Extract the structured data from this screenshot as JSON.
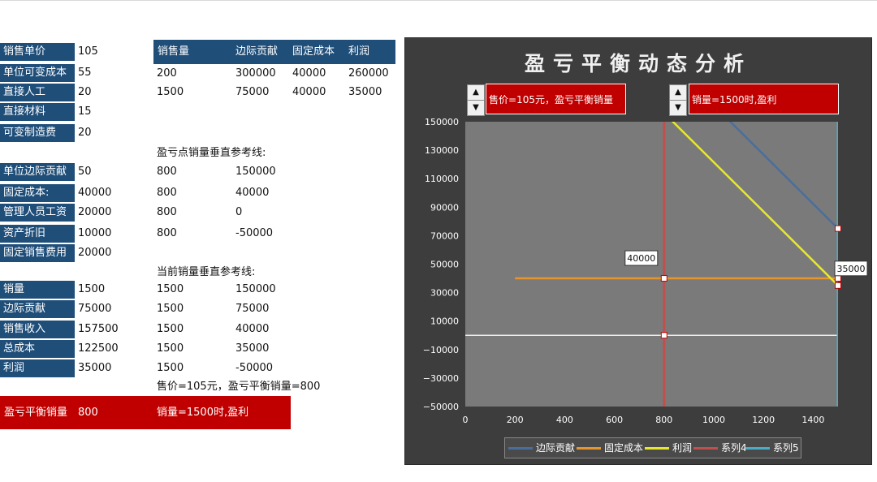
{
  "left_table": {
    "rows_a": [
      {
        "label": "销售单价",
        "value": "105"
      },
      {
        "label": "单位可变成本",
        "value": "55"
      },
      {
        "label": "直接人工",
        "value": "20"
      },
      {
        "label": "直接材料",
        "value": "15"
      },
      {
        "label": "可变制造费",
        "value": "20"
      }
    ],
    "rows_b": [
      {
        "label": "单位边际贡献",
        "value": "50"
      },
      {
        "label": "固定成本:",
        "value": "40000"
      },
      {
        "label": "管理人员工资",
        "value": "20000"
      },
      {
        "label": "资产折旧",
        "value": "10000"
      },
      {
        "label": "固定销售费用",
        "value": "20000"
      }
    ],
    "rows_c": [
      {
        "label": "销量",
        "value": "1500"
      },
      {
        "label": "边际贡献",
        "value": "75000"
      },
      {
        "label": "销售收入",
        "value": "157500"
      },
      {
        "label": "总成本",
        "value": "122500"
      },
      {
        "label": "利润",
        "value": "35000"
      }
    ]
  },
  "header": {
    "c1": "销售量",
    "c2": "边际贡献",
    "c3": "固定成本",
    "c4": "利润"
  },
  "table_rows": [
    {
      "c1": "200",
      "c2": "300000",
      "c3": "40000",
      "c4": "260000"
    },
    {
      "c1": "1500",
      "c2": "75000",
      "c3": "40000",
      "c4": "35000"
    }
  ],
  "ref1": {
    "title": "盈亏点销量垂直参考线:",
    "rows": [
      {
        "a": "800",
        "b": "150000"
      },
      {
        "a": "800",
        "b": "40000"
      },
      {
        "a": "800",
        "b": "0"
      },
      {
        "a": "800",
        "b": "-50000"
      }
    ]
  },
  "ref2": {
    "title": "当前销量垂直参考线:",
    "rows": [
      {
        "a": "1500",
        "b": "150000"
      },
      {
        "a": "1500",
        "b": "75000"
      },
      {
        "a": "1500",
        "b": "40000"
      },
      {
        "a": "1500",
        "b": "35000"
      },
      {
        "a": "1500",
        "b": "-50000"
      }
    ]
  },
  "summary_text": "售价=105元，盈亏平衡销量=800",
  "bottom_bar": {
    "label": "盈亏平衡销量",
    "value": "800",
    "status": "销量=1500时,盈利"
  },
  "chart": {
    "title": "盈亏平衡动态分析",
    "box1": "售价=105元，盈亏平衡销量=800",
    "box2": "销量=1500时,盈利",
    "spin_up": "▲",
    "spin_down": "▼"
  },
  "chart_data": {
    "type": "line",
    "xlim": [
      0,
      1500
    ],
    "ylim": [
      -50000,
      150000
    ],
    "xticks": [
      0,
      200,
      400,
      600,
      800,
      1000,
      1200,
      1400
    ],
    "yticks": [
      150000,
      130000,
      110000,
      90000,
      70000,
      50000,
      30000,
      10000,
      -10000,
      -30000,
      -50000
    ],
    "series": [
      {
        "name": "边际贡献",
        "color": "#4a6e9b",
        "x": [
          200,
          1500
        ],
        "y": [
          300000,
          75000
        ]
      },
      {
        "name": "固定成本",
        "color": "#e6962b",
        "x": [
          200,
          1500
        ],
        "y": [
          40000,
          40000
        ]
      },
      {
        "name": "利润",
        "color": "#e8e82a",
        "x": [
          200,
          1500
        ],
        "y": [
          260000,
          35000
        ]
      },
      {
        "name": "系列4",
        "color": "#c0504d",
        "x": [
          800,
          800,
          800,
          800
        ],
        "y": [
          150000,
          40000,
          0,
          -50000
        ]
      },
      {
        "name": "系列5",
        "color": "#4bacc6",
        "x": [
          1500,
          1500,
          1500,
          1500,
          1500
        ],
        "y": [
          150000,
          75000,
          40000,
          35000,
          -50000
        ]
      }
    ],
    "data_labels": [
      {
        "x": 800,
        "y": 40000,
        "text": "40000"
      },
      {
        "x": 1500,
        "y": 35000,
        "text": "35000"
      }
    ],
    "zero_line": true,
    "legend_position": "bottom"
  }
}
